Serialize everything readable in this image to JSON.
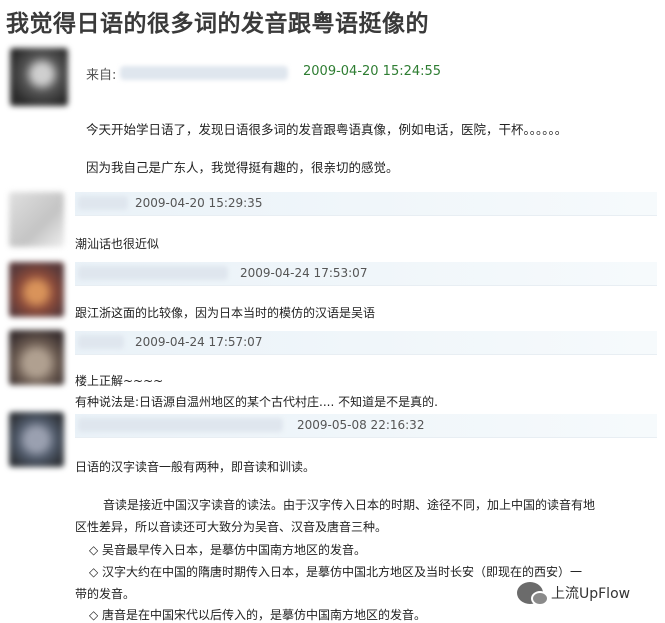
{
  "post": {
    "title": "我觉得日语的很多词的发音跟粤语挺像的",
    "from_label": "来自:",
    "time": "2009-04-20 15:24:55",
    "body": [
      "今天开始学日语了，发现日语很多词的发音跟粤语真像，例如电话，医院，干杯。。。。。。",
      "因为我自己是广东人，我觉得挺有趣的，很亲切的感觉。"
    ]
  },
  "replies": [
    {
      "time": "2009-04-20 15:29:35",
      "lines": [
        "潮汕话也很近似"
      ]
    },
    {
      "time": "2009-04-24 17:53:07",
      "lines": [
        "跟江浙这面的比较像，因为日本当时的模仿的汉语是吴语"
      ]
    },
    {
      "time": "2009-04-24 17:57:07",
      "lines": [
        "楼上正解~~~~",
        "有种说法是:日语源自温州地区的某个古代村庄.... 不知道是不是真的."
      ]
    },
    {
      "time": "2009-05-08 22:16:32",
      "lines": [
        "日语的汉字读音一般有两种，即音读和训读。",
        "音读是接近中国汉字读音的读法。由于汉字传入日本的时期、途径不同，加上中国的读音有地",
        "区性差异，所以音读还可大致分为吴音、汉音及唐音三种。",
        "◇ 吴音最早传入日本，是摹仿中国南方地区的发音。",
        "◇ 汉字大约在中国的隋唐时期传入日本，是摹仿中国北方地区及当时长安（即现在的西安）一",
        "带的发音。",
        "◇ 唐音是在中国宋代以后传入的，是摹仿中国南方地区的发音。"
      ]
    }
  ],
  "watermark": {
    "text": "上流UpFlow",
    "icon": "wechat-icon"
  },
  "colors": {
    "timestamp_main": "#2e7d32",
    "reply_bar": "#eaf2f8"
  }
}
